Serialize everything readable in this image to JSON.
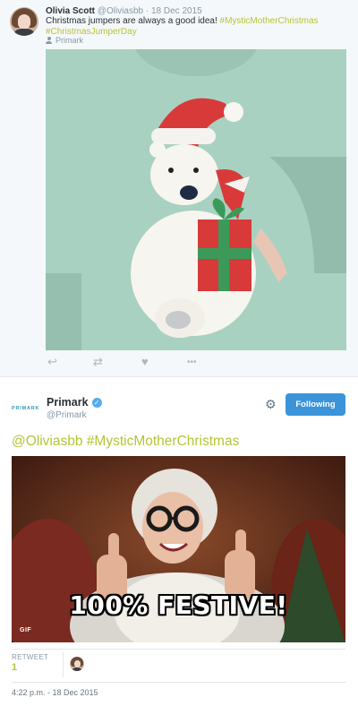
{
  "reply_tweet": {
    "name": "Olivia Scott",
    "handle": "@Oliviasbb",
    "separator": "·",
    "date": "18 Dec 2015",
    "text": "Christmas jumpers are always a good idea! ",
    "hashtag_1": "#MysticMotherChristmas",
    "hashtag_2": "#ChristmasJumperDay",
    "source_account": "Primark",
    "icons": {
      "source": "user-icon",
      "reply": "reply-icon",
      "retweet": "retweet-icon",
      "like": "heart-icon",
      "more": "more-icon"
    },
    "action_glyphs": {
      "reply": "↩",
      "retweet": "⇄",
      "like": "♥",
      "more": "•••"
    }
  },
  "main_tweet": {
    "logo_text": "PRIMARK",
    "name": "Primark",
    "verified_glyph": "✓",
    "handle": "@Primark",
    "settings_glyph": "⚙",
    "follow_button_label": "Following",
    "mention": "@Oliviasbb",
    "hashtag": "#MysticMotherChristmas",
    "media": {
      "caption": "100% FESTIVE!",
      "badge": "GIF"
    },
    "stats": {
      "retweet_label": "RETWEET",
      "retweet_count": "1"
    },
    "timestamp": "4:22 p.m. - 18 Dec 2015"
  },
  "colors": {
    "accent_green": "#b7c436",
    "follow_blue": "#3b94d9",
    "verified_blue": "#55acee",
    "muted_text": "#8899a6"
  }
}
